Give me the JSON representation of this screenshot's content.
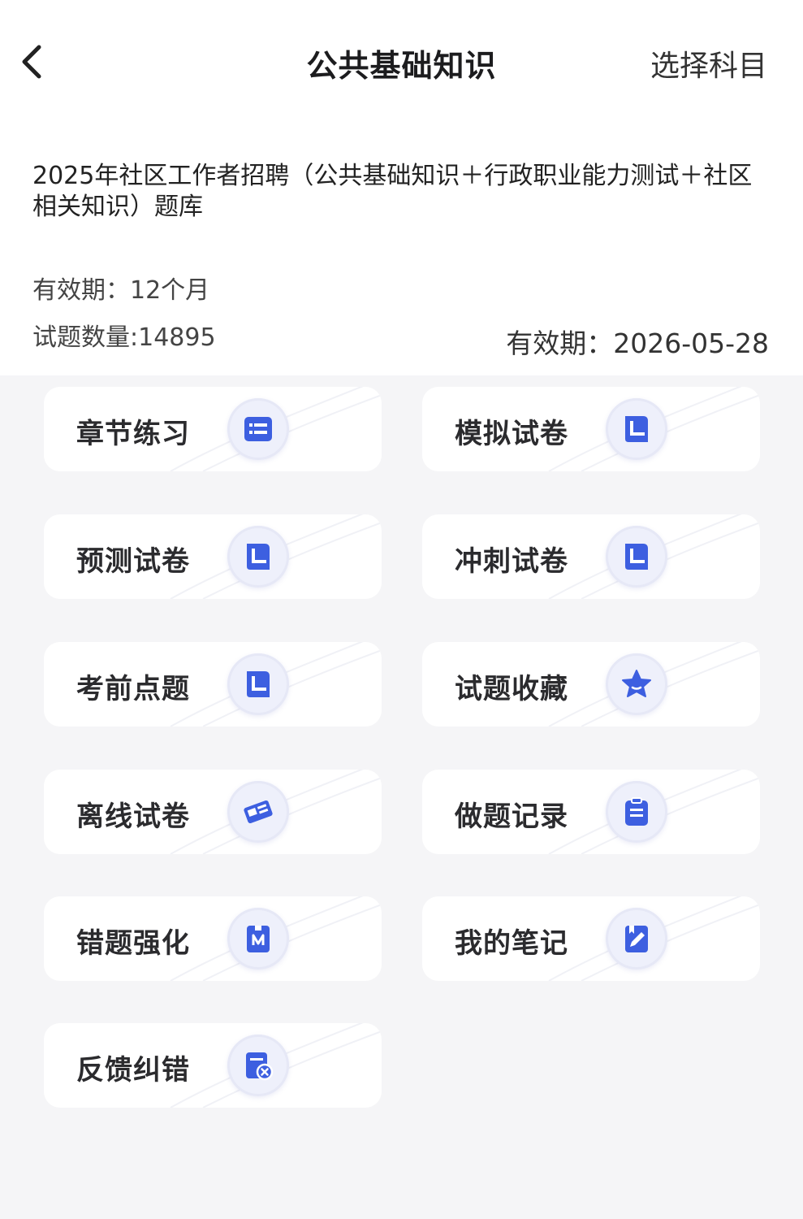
{
  "nav": {
    "back_icon": "chevron-left-icon",
    "title": "公共基础知识",
    "action": "选择科目"
  },
  "bank": {
    "title": "2025年社区工作者招聘（公共基础知识＋行政职业能力测试＋社区相关知识）题库",
    "validity": "有效期：12个月",
    "question_count": "试题数量:14895",
    "expire_date": "有效期：2026-05-28"
  },
  "menu": [
    {
      "label": "章节练习",
      "icon": "list-icon"
    },
    {
      "label": "模拟试卷",
      "icon": "paper-icon"
    },
    {
      "label": "预测试卷",
      "icon": "paper-icon"
    },
    {
      "label": "冲刺试卷",
      "icon": "paper-icon"
    },
    {
      "label": "考前点题",
      "icon": "paper-icon"
    },
    {
      "label": "试题收藏",
      "icon": "star-icon"
    },
    {
      "label": "离线试卷",
      "icon": "ticket-icon"
    },
    {
      "label": "做题记录",
      "icon": "clipboard-icon"
    },
    {
      "label": "错题强化",
      "icon": "bookmark-icon"
    },
    {
      "label": "我的笔记",
      "icon": "note-pen-icon"
    },
    {
      "label": "反馈纠错",
      "icon": "report-error-icon"
    }
  ],
  "colors": {
    "accent": "#3d5fe0",
    "card_bg": "#ffffff",
    "page_bg": "#f5f5f7"
  }
}
